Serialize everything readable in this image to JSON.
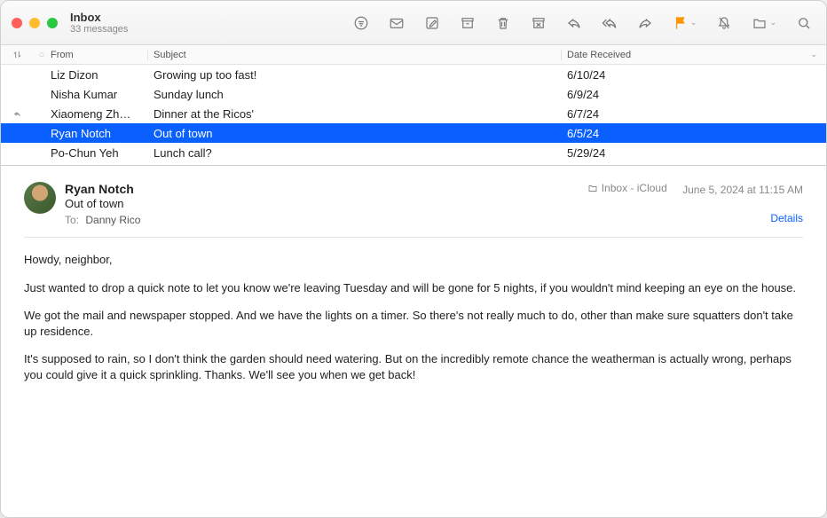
{
  "titlebar": {
    "title": "Inbox",
    "subtitle": "33 messages"
  },
  "columns": {
    "from": "From",
    "subject": "Subject",
    "date": "Date Received"
  },
  "messages": [
    {
      "from": "Liz Dizon",
      "subject": "Growing up too fast!",
      "date": "6/10/24",
      "replied": false,
      "selected": false
    },
    {
      "from": "Nisha Kumar",
      "subject": "Sunday lunch",
      "date": "6/9/24",
      "replied": false,
      "selected": false
    },
    {
      "from": "Xiaomeng Zh…",
      "subject": "Dinner at the Ricos'",
      "date": "6/7/24",
      "replied": true,
      "selected": false
    },
    {
      "from": "Ryan Notch",
      "subject": "Out of town",
      "date": "6/5/24",
      "replied": false,
      "selected": true
    },
    {
      "from": "Po-Chun Yeh",
      "subject": "Lunch call?",
      "date": "5/29/24",
      "replied": false,
      "selected": false
    }
  ],
  "preview": {
    "sender": "Ryan Notch",
    "subject": "Out of town",
    "to_label": "To:",
    "to_value": "Danny Rico",
    "mailbox": "Inbox - iCloud",
    "datetime": "June 5, 2024 at 11:15 AM",
    "details": "Details",
    "body": {
      "p1": "Howdy, neighbor,",
      "p2": "Just wanted to drop a quick note to let you know we're leaving Tuesday and will be gone for 5 nights, if you wouldn't mind keeping an eye on the house.",
      "p3": "We got the mail and newspaper stopped. And we have the lights on a timer. So there's not really much to do, other than make sure squatters don't take up residence.",
      "p4": "It's supposed to rain, so I don't think the garden should need watering. But on the incredibly remote chance the weatherman is actually wrong, perhaps you could give it a quick sprinkling. Thanks. We'll see you when we get back!"
    }
  }
}
